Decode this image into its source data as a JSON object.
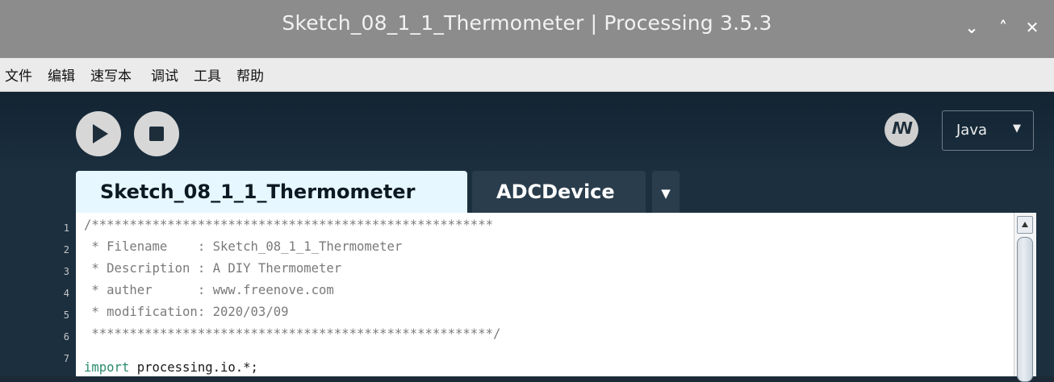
{
  "window": {
    "title": "Sketch_08_1_1_Thermometer | Processing 3.5.3",
    "controls": {
      "minimize": "⌄",
      "maximize": "˄",
      "close": "✕"
    }
  },
  "menu": {
    "items": [
      "文件",
      "编辑",
      "速写本",
      "调试",
      "工具",
      "帮助"
    ]
  },
  "toolbar": {
    "run": "run-icon",
    "stop": "stop-icon",
    "debug_glyph": "ꞁꞁ",
    "mode_label": "Java",
    "mode_arrow": "▼"
  },
  "tabs": {
    "active": "Sketch_08_1_1_Thermometer",
    "other": "ADCDevice",
    "menu_arrow": "▼"
  },
  "editor": {
    "line_numbers": [
      "1",
      "2",
      "3",
      "4",
      "5",
      "6",
      "7"
    ],
    "lines": [
      "/*****************************************************",
      " * Filename    : Sketch_08_1_1_Thermometer",
      " * Description : A DIY Thermometer",
      " * auther      : www.freenove.com",
      " * modification: 2020/03/09",
      " *****************************************************/"
    ],
    "line7_keyword": "import",
    "line7_rest": " processing.io.*;"
  },
  "colors": {
    "titlebar": "#8c8c8c",
    "background": "#1b2f3f",
    "active_tab": "#e6f7ff",
    "inactive_tab": "#2a3d4c",
    "keyword": "#2a8b6f",
    "comment": "#7a7a7a"
  }
}
